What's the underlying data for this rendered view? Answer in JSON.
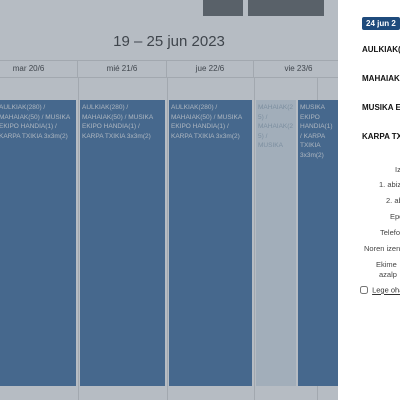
{
  "calendar": {
    "title": "19 – 25 jun 2023",
    "days": [
      {
        "label": "mar 20/6"
      },
      {
        "label": "mié 21/6"
      },
      {
        "label": "jue 22/6"
      },
      {
        "label": "vie 23/6"
      }
    ],
    "events": [
      {
        "text": "AULKIAK(280) / MAHAIAK(50) / MUSIKA EKIPO HANDIA(1) / KARPA TXIKIA 3x3m(2)"
      },
      {
        "text": "AULKIAK(280) / MAHAIAK(50) / MUSIKA EKIPO HANDIA(1) / KARPA TXIKIA 3x3m(2)"
      },
      {
        "text": "AULKIAK(280) / MAHAIAK(50) / MUSIKA EKIPO HANDIA(1) / KARPA TXIKIA 3x3m(2)"
      },
      {
        "text": "MAHAIAK(25) / MAHAIAK(25) / MUSIKA"
      },
      {
        "text": "MUSIKA EKIPO HANDIA(1) / KARPA TXIKIA 3x3m(2)"
      }
    ]
  },
  "sidebar": {
    "date_badge": "24 jun 2",
    "event_titles": [
      "AULKIAK(2",
      "MAHAIAK(",
      "MUSIKA EI",
      "KARPA TXI"
    ],
    "form_labels": [
      "Iz",
      "1. abiz",
      "2. ab",
      "Epo",
      "Telefo",
      "Noren izen",
      "Ekime",
      "azalp"
    ],
    "checkbox_label": "Lege oha"
  }
}
